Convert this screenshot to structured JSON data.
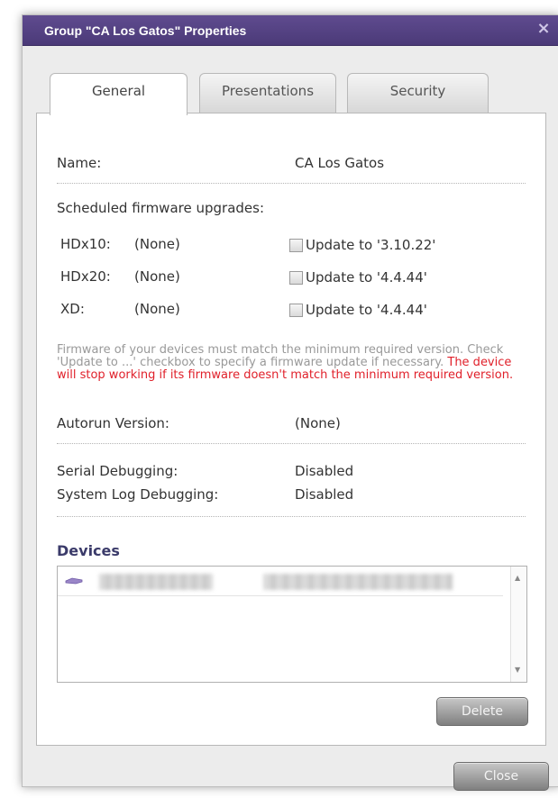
{
  "dialog": {
    "title": "Group \"CA Los Gatos\" Properties",
    "close_glyph": "×",
    "accent_color": "#4b3a78"
  },
  "tabs": [
    {
      "label": "General",
      "active": true
    },
    {
      "label": "Presentations",
      "active": false
    },
    {
      "label": "Security",
      "active": false
    }
  ],
  "general": {
    "name_label": "Name:",
    "name_value": "CA Los Gatos",
    "scheduled_label": "Scheduled firmware upgrades:",
    "firmware_rows": [
      {
        "model": "HDx10:",
        "current": "(None)",
        "update_label": "Update to '3.10.22'",
        "checked": false
      },
      {
        "model": "HDx20:",
        "current": "(None)",
        "update_label": "Update to '4.4.44'",
        "checked": false
      },
      {
        "model": "XD:",
        "current": "(None)",
        "update_label": "Update to '4.4.44'",
        "checked": false
      }
    ],
    "note_text": "Firmware of your devices must match the minimum required version. Check 'Update to ...' checkbox to specify a firmware update if necessary. ",
    "note_warning": "The device will stop working if its firmware doesn't match the minimum required version.",
    "autorun_label": "Autorun Version:",
    "autorun_value": "(None)",
    "serial_label": "Serial Debugging:",
    "serial_value": "Disabled",
    "syslog_label": "System Log Debugging:",
    "syslog_value": "Disabled"
  },
  "devices": {
    "title": "Devices",
    "icon": "device-icon",
    "delete_label": "Delete"
  },
  "footer": {
    "close_label": "Close"
  }
}
